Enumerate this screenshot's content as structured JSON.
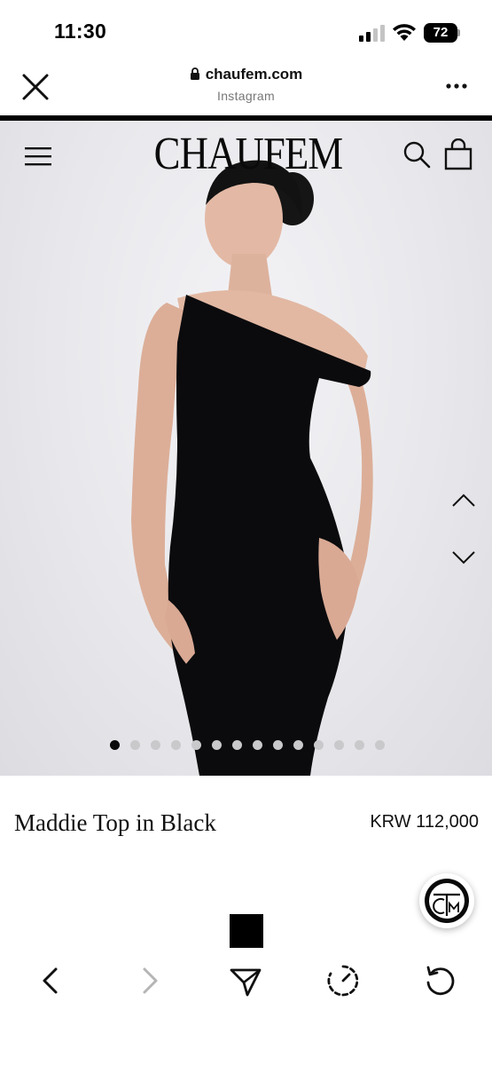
{
  "status_bar": {
    "time": "11:30",
    "battery": "72"
  },
  "browser": {
    "domain": "chaufem.com",
    "source": "Instagram"
  },
  "site": {
    "brand": "CHAUFEM"
  },
  "carousel": {
    "slide_count": 14,
    "active_index": 0
  },
  "product": {
    "name": "Maddie Top in Black",
    "price": "KRW 112,000",
    "selected_color": "#000000"
  },
  "colors": {
    "accent": "#000000",
    "dot_inactive": "#c9c9cc",
    "subtitle": "#777777"
  },
  "icons": {
    "close": "close-icon",
    "lock": "lock-icon",
    "more": "more-icon",
    "menu": "hamburger-menu-icon",
    "search": "search-icon",
    "bag": "shopping-bag-icon",
    "up": "chevron-up-icon",
    "down": "chevron-down-icon",
    "back": "chevron-left-icon",
    "forward": "chevron-right-icon",
    "share": "send-icon",
    "timer": "timer-icon",
    "reload": "reload-icon",
    "chat": "chat-logo-icon"
  }
}
